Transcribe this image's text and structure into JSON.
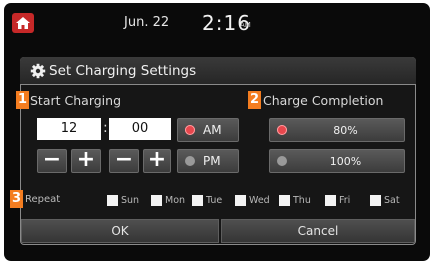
{
  "status_bar": {
    "date": "Jun. 22",
    "time": "2:16",
    "ampm": "AM"
  },
  "dialog": {
    "title": "Set Charging Settings",
    "start_charging": {
      "badge": "1",
      "label": "Start Charging",
      "hour": "12",
      "minute": "00",
      "am_label": "AM",
      "pm_label": "PM",
      "selected_period": "AM"
    },
    "charge_completion": {
      "badge": "2",
      "label": "Charge Completion",
      "options": [
        "80%",
        "100%"
      ],
      "selected": "80%"
    },
    "repeat": {
      "badge": "3",
      "label": "Repeat",
      "days": [
        "Sun",
        "Mon",
        "Tue",
        "Wed",
        "Thu",
        "Fri",
        "Sat"
      ]
    },
    "ok_label": "OK",
    "cancel_label": "Cancel"
  },
  "stepper": {
    "minus": "−",
    "plus": "+"
  },
  "colors": {
    "badge": "#f47d20",
    "home": "#c62828",
    "radio_selected": "#e8474d"
  },
  "icons": [
    "home-icon",
    "gear-icon"
  ]
}
